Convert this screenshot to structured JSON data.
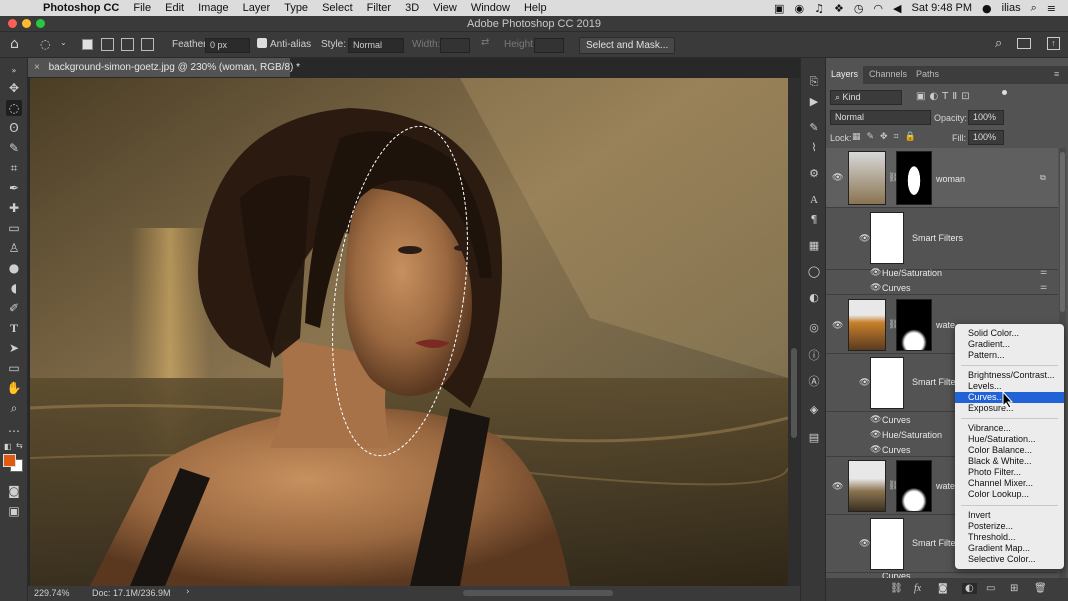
{
  "menubar": {
    "app": "Photoshop CC",
    "items": [
      "File",
      "Edit",
      "Image",
      "Layer",
      "Type",
      "Select",
      "Filter",
      "3D",
      "View",
      "Window",
      "Help"
    ],
    "clock": "Sat 9:48 PM",
    "user": "ilias"
  },
  "window_title": "Adobe Photoshop CC 2019",
  "options": {
    "feather_label": "Feather:",
    "feather_value": "0 px",
    "antialias_label": "Anti-alias",
    "style_label": "Style:",
    "style_value": "Normal",
    "width_label": "Width:",
    "height_label": "Height:",
    "select_mask": "Select and Mask..."
  },
  "document": {
    "tab_title": "background-simon-goetz.jpg @ 230% (woman, RGB/8) *",
    "zoom": "229.74%",
    "doc_size": "Doc: 17.1M/236.9M"
  },
  "panel": {
    "tabs": [
      "Layers",
      "Channels",
      "Paths"
    ],
    "filter_kind": "Kind",
    "blend_mode": "Normal",
    "opacity_label": "Opacity:",
    "opacity_value": "100%",
    "lock_label": "Lock:",
    "fill_label": "Fill:",
    "fill_value": "100%",
    "layers": [
      {
        "name": "woman"
      },
      {
        "name": "Smart Filters"
      },
      {
        "name": "Hue/Saturation"
      },
      {
        "name": "Curves"
      },
      {
        "name": "wate"
      },
      {
        "name": "Smart Filte"
      },
      {
        "name": "Curves"
      },
      {
        "name": "Hue/Saturation"
      },
      {
        "name": "Curves"
      },
      {
        "name": "wate"
      },
      {
        "name": "Smart Filte"
      },
      {
        "name": "Curves"
      }
    ]
  },
  "adjustment_menu": {
    "group1": [
      "Solid Color...",
      "Gradient...",
      "Pattern..."
    ],
    "group2": [
      "Brightness/Contrast...",
      "Levels...",
      "Curves...",
      "Exposure..."
    ],
    "group3": [
      "Vibrance...",
      "Hue/Saturation...",
      "Color Balance...",
      "Black & White...",
      "Photo Filter...",
      "Channel Mixer...",
      "Color Lookup..."
    ],
    "group4": [
      "Invert",
      "Posterize...",
      "Threshold...",
      "Gradient Map...",
      "Selective Color..."
    ],
    "highlighted": "Curves..."
  },
  "colors": {
    "foreground": "#e05a12",
    "background": "#ffffff",
    "highlight": "#2163d7"
  }
}
